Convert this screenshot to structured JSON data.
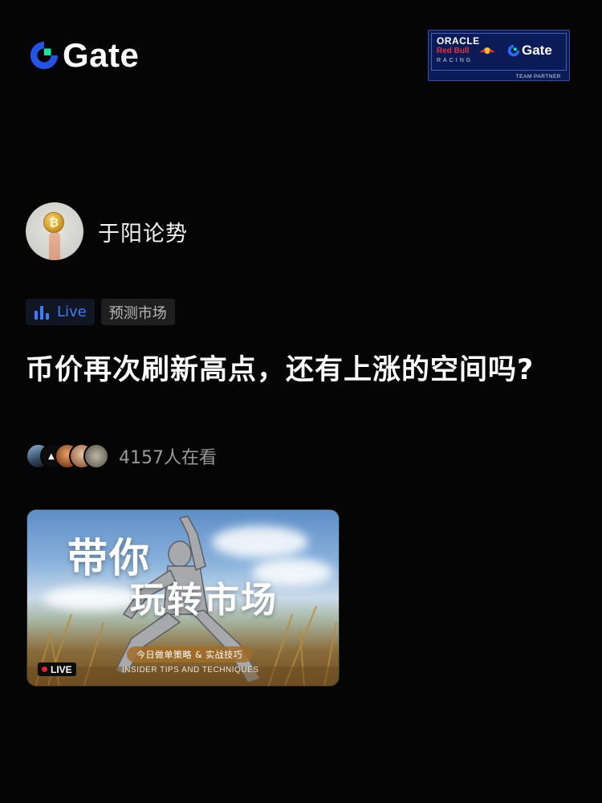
{
  "header": {
    "logo_text": "Gate",
    "partner_badge": {
      "line1": "ORACLE",
      "line2": "Red Bull",
      "line3": "RACING",
      "gate_text": "Gate",
      "footer": "TEAM PARTNER"
    }
  },
  "author": {
    "name": "于阳论势",
    "avatar_icon": "bitcoin-coin-avatar"
  },
  "tags": {
    "live_label": "Live",
    "live_icon": "bar-chart-icon",
    "category_label": "预测市场"
  },
  "post": {
    "title": "币价再次刷新高点，还有上涨的空间吗?"
  },
  "viewers": {
    "count_text": "4157人在看",
    "avatar_count": 5
  },
  "banner": {
    "headline_1": "带你",
    "headline_2": "玩转市场",
    "pill_text": "今日做单策略 & 实战技巧",
    "subtitle": "INSIDER TIPS AND TECHNIQUES",
    "live_badge": "LIVE"
  },
  "colors": {
    "background": "#050505",
    "accent_blue": "#3f7cf6",
    "live_red": "#e8212b",
    "gate_green": "#17e5a3",
    "gate_blue": "#2354e6"
  }
}
